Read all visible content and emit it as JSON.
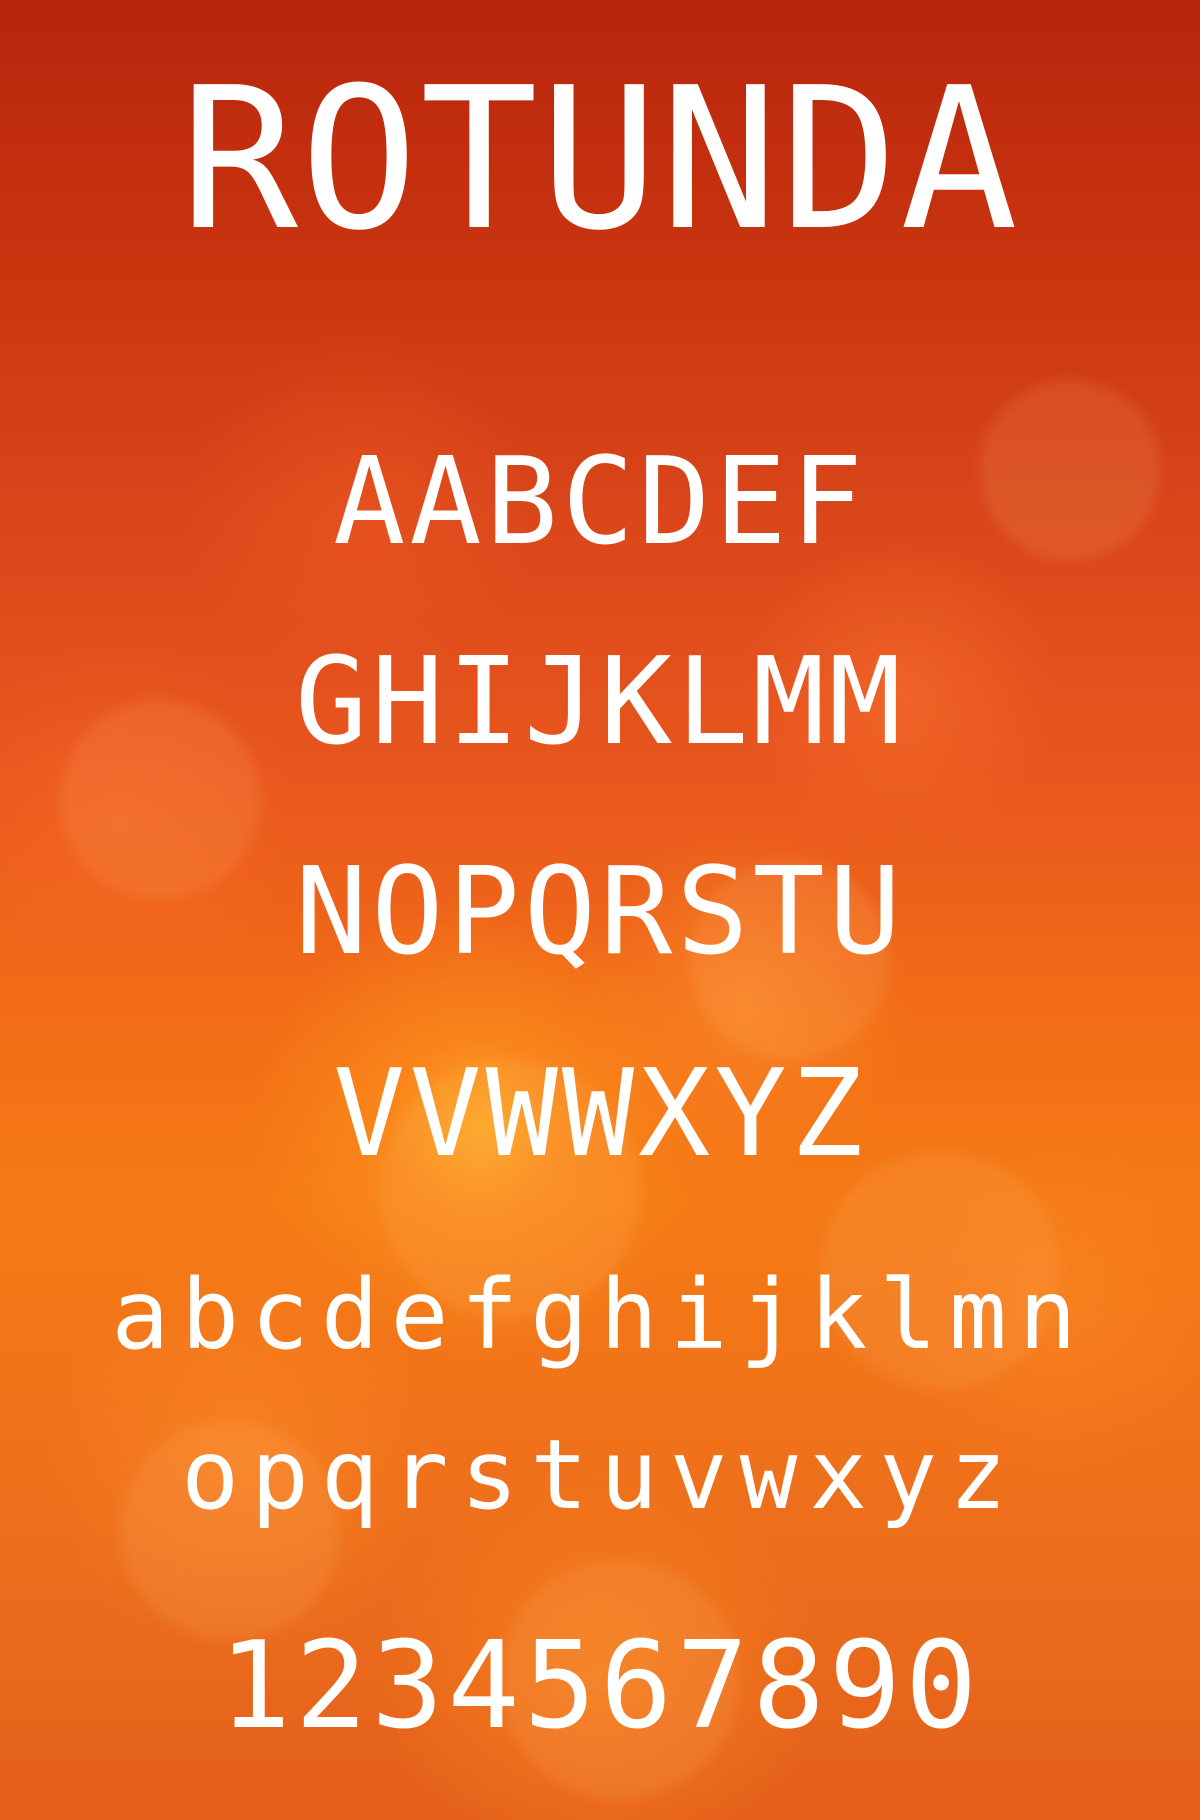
{
  "title": "ROTUNDA",
  "alphabet": {
    "uppercase_row_1": "AABCDEF",
    "uppercase_row_2": "GHIJKLMM",
    "uppercase_row_3": "NOPQRSTU",
    "uppercase_row_4": "VVWWXYZ",
    "lowercase_row_1": "abcdefghijklmn",
    "lowercase_row_2": "opqrstuvwxyz",
    "digits": "1234567890"
  },
  "colors": {
    "text": "#ffffff",
    "background_top": "#b8250d",
    "background_bottom": "#f57a15"
  }
}
